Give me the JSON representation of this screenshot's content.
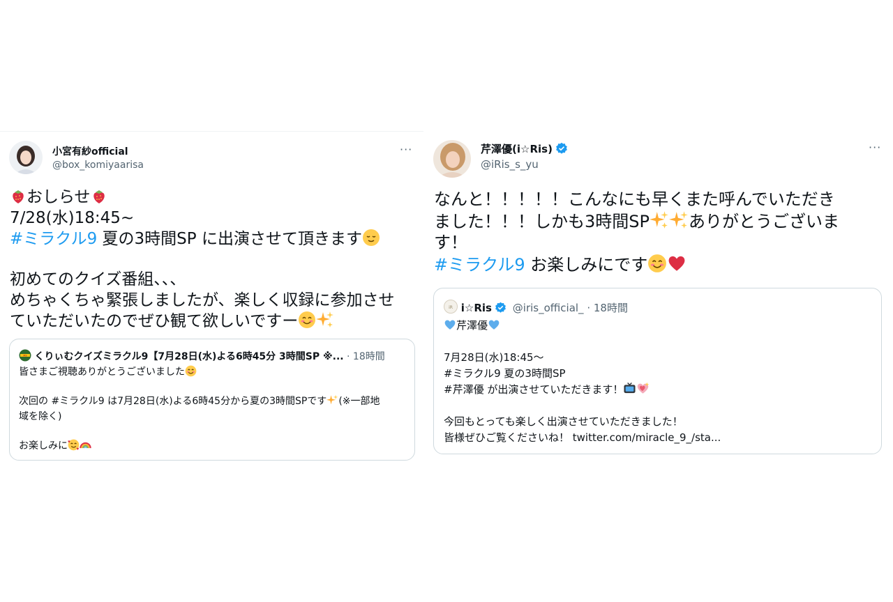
{
  "left_tweet": {
    "display_name": "小宮有紗official",
    "handle": "@box_komiyaarisa",
    "more": "···",
    "lines": {
      "l1": "おしらせ",
      "l2": "7/28(水)18:45~",
      "l3_tag": "#ミラクル9",
      "l3_rest": " 夏の3時間SP に出演させて頂きます",
      "l4": "初めてのクイズ番組、、、",
      "l5": "めちゃくちゃ緊張しましたが、楽しく収録に参加させ",
      "l6": "ていただいたのでぜひ観て欲しいですー"
    },
    "quote": {
      "name": "くりぃむクイズミラクル9【7月28日(水)よる6時45分 3時間SP ※...",
      "meta": " · 18時間",
      "q1": "皆さまご視聴ありがとうございました",
      "q2": "次回の #ミラクル9 は7月28日(水)よる6時45分から夏の3時間SPです",
      "q2b": "(※一部地",
      "q3": "域を除く)",
      "q4": "お楽しみに"
    }
  },
  "right_tweet": {
    "display_name": "芹澤優(i☆Ris)",
    "handle": "@iRis_s_yu",
    "more": "···",
    "lines": {
      "l1": "なんと！！！！！こんなにも早くまた呼んでいただき",
      "l2a": "ました！！！しかも3時間SP",
      "l2b": "ありがとうございま",
      "l3": "す！",
      "l4_tag": "#ミラクル9",
      "l4_rest": " お楽しみにです"
    },
    "quote": {
      "name": "i☆Ris",
      "meta": "@iris_official_ · 18時間",
      "q1": "芹澤優",
      "q2": "7月28日(水)18:45～",
      "q3": "#ミラクル9 夏の3時間SP",
      "q4": "#芹澤優 が出演させていただきます！",
      "q5": "今回もとっても楽しく出演させていただきました！",
      "q6": "皆様ぜひご覧くださいね！ twitter.com/miracle_9_/sta..."
    }
  },
  "colors": {
    "link": "#1d9bf0",
    "verified": "#1d9bf0",
    "secondary": "#536471",
    "border": "#cfd9de"
  }
}
